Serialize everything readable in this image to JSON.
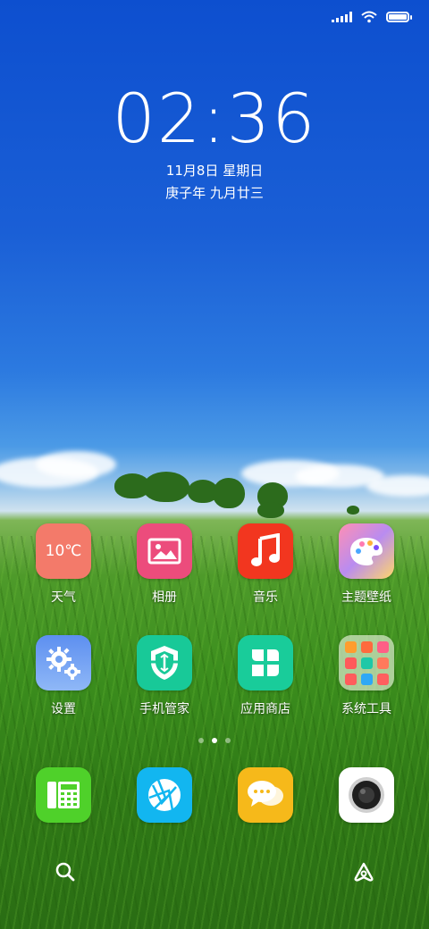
{
  "status_bar": {
    "signal_icon": "cellular-signal-icon",
    "wifi_icon": "wifi-icon",
    "battery_icon": "battery-icon",
    "battery_level": 1.0
  },
  "lock": {
    "time": "02:36",
    "date": "11月8日 星期日",
    "lunar_date": "庚子年 九月廿三"
  },
  "apps": [
    {
      "label": "天气",
      "icon": "weather-icon",
      "icon_text": "10℃",
      "color": "#f37a6a"
    },
    {
      "label": "相册",
      "icon": "gallery-icon",
      "color": "#ec4c7c"
    },
    {
      "label": "音乐",
      "icon": "music-icon",
      "color": "#f2361f"
    },
    {
      "label": "主题壁纸",
      "icon": "themes-icon",
      "color": "#b98cf0"
    },
    {
      "label": "设置",
      "icon": "settings-icon",
      "color": "#6e9ff2"
    },
    {
      "label": "手机管家",
      "icon": "security-icon",
      "color": "#18c998"
    },
    {
      "label": "应用商店",
      "icon": "app-store-icon",
      "color": "#19cc9a"
    },
    {
      "label": "系统工具",
      "icon": "folder-icon",
      "color": "#c7d9b5"
    }
  ],
  "page_indicator": {
    "count": 3,
    "active": 1
  },
  "dock": [
    {
      "name": "phone",
      "icon": "phone-icon",
      "color": "#4fd12a"
    },
    {
      "name": "browser",
      "icon": "browser-icon",
      "color": "#12b6f0"
    },
    {
      "name": "messages",
      "icon": "messages-icon",
      "color": "#f6b91a"
    },
    {
      "name": "camera",
      "icon": "camera-icon",
      "color": "#ffffff"
    }
  ],
  "bottom": {
    "search_icon": "search-icon",
    "assistant_icon": "assistant-icon"
  }
}
